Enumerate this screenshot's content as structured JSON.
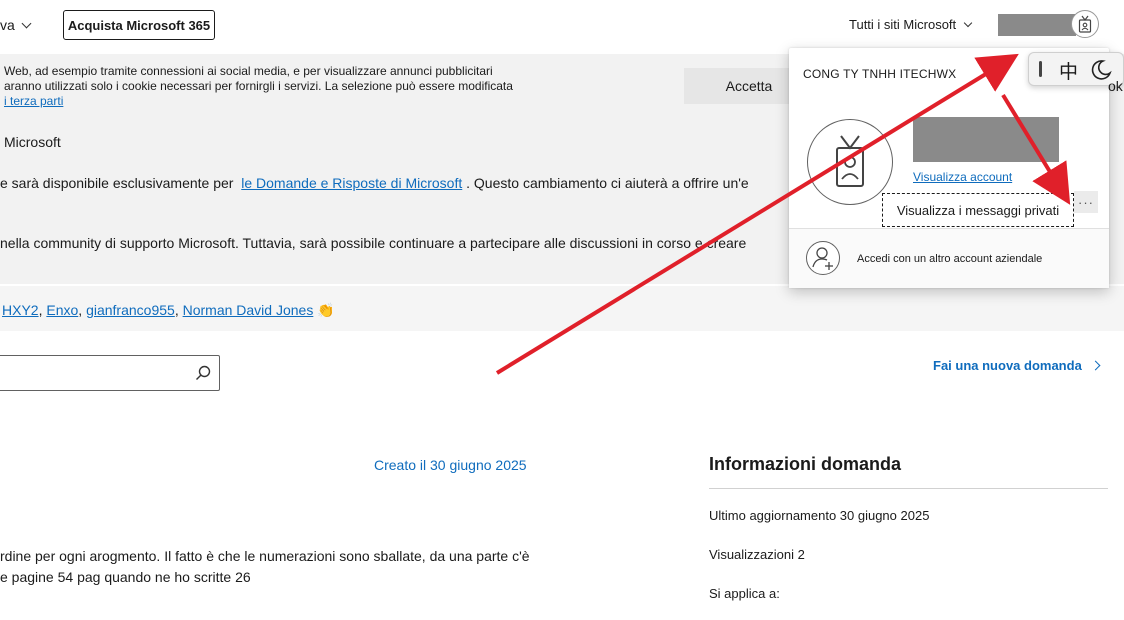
{
  "header": {
    "nav_partial": "va",
    "buy_button": "Acquista Microsoft 365",
    "all_sites": "Tutti i siti Microsoft"
  },
  "cookie": {
    "line1": "Web, ad esempio tramite connessioni ai social media, e per visualizzare annunci pubblicitari",
    "line2": "aranno utilizzati solo i cookie necessari per fornirgli i servizi. La selezione può essere modificata",
    "link": "i terza parti",
    "accept_button": "Accetta"
  },
  "notice": {
    "heading": "Microsoft",
    "line1_pre": "e sarà disponibile esclusivamente per",
    "line1_link": "le Domande e Risposte di Microsoft",
    "line1_post": ". Questo cambiamento ci aiuterà a offrire un'e",
    "line2": "nella community di supporto Microsoft. Tuttavia, sarà possibile continuare a partecipare alle discussioni in corso e creare"
  },
  "users": {
    "names": [
      "HXY2",
      "Enxo",
      "gianfranco955",
      "Norman David Jones"
    ],
    "emoji": "👏"
  },
  "search": {
    "placeholder": ""
  },
  "new_question": "Fai una nuova domanda",
  "question": {
    "created": "Creato il 30 giugno 2025",
    "body_line1": "rdine per ogni arogmento. Il fatto è che le numerazioni sono sballate, da una parte c'è",
    "body_line2": "e pagine 54 pag quando ne ho scritte 26"
  },
  "info": {
    "title": "Informazioni domanda",
    "updated": "Ultimo aggiornamento 30 giugno 2025",
    "views": "Visualizzazioni 2",
    "applies": "Si applica a:"
  },
  "account_popup": {
    "org": "CONG TY TNHH ITECHWX",
    "view_account": "Visualizza account",
    "view_messages": "Visualizza i messaggi privati",
    "more": "···",
    "other_account": "Accedi con un altro account aziendale"
  },
  "ime": {
    "lang": "中",
    "partial_right": "ok"
  },
  "colors": {
    "link": "#0f6cbd",
    "annotation_arrow": "#e0202a",
    "banner_bg": "#f2f2f2",
    "redaction": "#8a8a8a"
  }
}
